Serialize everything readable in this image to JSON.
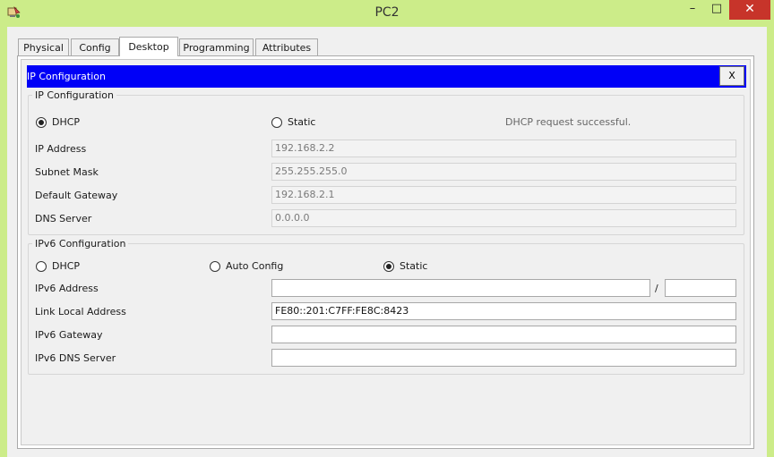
{
  "window": {
    "title": "PC2",
    "minimize": "–",
    "maximize": "□",
    "close": "✕"
  },
  "tabs": [
    {
      "label": "Physical"
    },
    {
      "label": "Config"
    },
    {
      "label": "Desktop"
    },
    {
      "label": "Programming"
    },
    {
      "label": "Attributes"
    }
  ],
  "header": {
    "title": "IP Configuration",
    "close_label": "X"
  },
  "ipv4": {
    "legend": "IP Configuration",
    "dhcp_label": "DHCP",
    "static_label": "Static",
    "selected": "DHCP",
    "status": "DHCP request successful.",
    "ip_label": "IP Address",
    "ip_value": "192.168.2.2",
    "mask_label": "Subnet Mask",
    "mask_value": "255.255.255.0",
    "gateway_label": "Default Gateway",
    "gateway_value": "192.168.2.1",
    "dns_label": "DNS Server",
    "dns_value": "0.0.0.0"
  },
  "ipv6": {
    "legend": "IPv6 Configuration",
    "dhcp_label": "DHCP",
    "auto_label": "Auto Config",
    "static_label": "Static",
    "selected": "Static",
    "address_label": "IPv6 Address",
    "address_value": "",
    "prefix_separator": "/",
    "prefix_value": "",
    "link_local_label": "Link Local Address",
    "link_local_value": "FE80::201:C7FF:FE8C:8423",
    "gateway_label": "IPv6 Gateway",
    "gateway_value": "",
    "dns_label": "IPv6 DNS Server",
    "dns_value": ""
  },
  "colors": {
    "frame": "#ccec89",
    "header_bar": "#0000f7",
    "close_button": "#c7342a"
  }
}
